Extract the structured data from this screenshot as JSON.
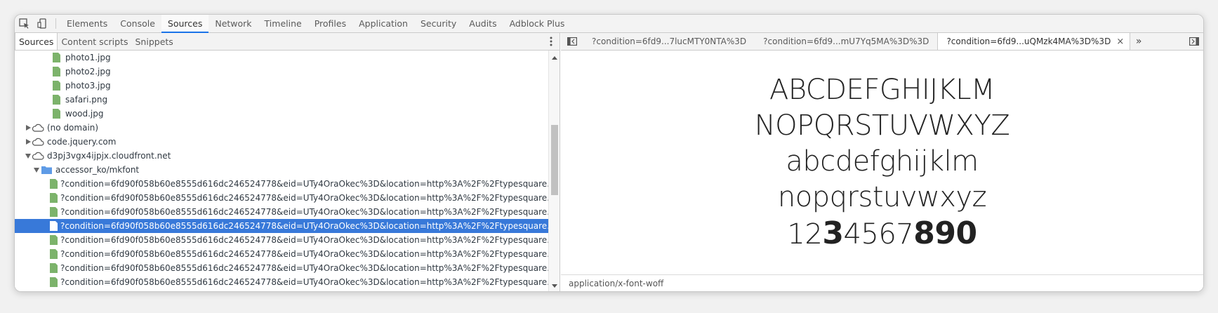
{
  "toolbar": {
    "tabs": [
      {
        "label": "Elements"
      },
      {
        "label": "Console"
      },
      {
        "label": "Sources"
      },
      {
        "label": "Network"
      },
      {
        "label": "Timeline"
      },
      {
        "label": "Profiles"
      },
      {
        "label": "Application"
      },
      {
        "label": "Security"
      },
      {
        "label": "Audits"
      },
      {
        "label": "Adblock Plus"
      }
    ],
    "active_tab": "Sources"
  },
  "navigator": {
    "tabs": [
      {
        "label": "Sources"
      },
      {
        "label": "Content scripts"
      },
      {
        "label": "Snippets"
      }
    ]
  },
  "tree": {
    "files_top": [
      {
        "label": "photo1.jpg"
      },
      {
        "label": "photo2.jpg"
      },
      {
        "label": "photo3.jpg"
      },
      {
        "label": "safari.png"
      },
      {
        "label": "wood.jpg"
      }
    ],
    "domains": [
      {
        "label": "(no domain)"
      },
      {
        "label": "code.jquery.com"
      },
      {
        "label": "d3pj3vgx4ijpjx.cloudfront.net"
      }
    ],
    "folder": {
      "label": "accessor_ko/mkfont"
    },
    "font_files": [
      {
        "label": "?condition=6fd90f058b60e8555d616dc246524778&eid=UTy4OraOkec%3D&location=http%3A%2F%2Ftypesquare.com..."
      },
      {
        "label": "?condition=6fd90f058b60e8555d616dc246524778&eid=UTy4OraOkec%3D&location=http%3A%2F%2Ftypesquare.com..."
      },
      {
        "label": "?condition=6fd90f058b60e8555d616dc246524778&eid=UTy4OraOkec%3D&location=http%3A%2F%2Ftypesquare.com..."
      },
      {
        "label": "?condition=6fd90f058b60e8555d616dc246524778&eid=UTy4OraOkec%3D&location=http%3A%2F%2Ftypesquare.com..."
      },
      {
        "label": "?condition=6fd90f058b60e8555d616dc246524778&eid=UTy4OraOkec%3D&location=http%3A%2F%2Ftypesquare.com..."
      },
      {
        "label": "?condition=6fd90f058b60e8555d616dc246524778&eid=UTy4OraOkec%3D&location=http%3A%2F%2Ftypesquare.com..."
      },
      {
        "label": "?condition=6fd90f058b60e8555d616dc246524778&eid=UTy4OraOkec%3D&location=http%3A%2F%2Ftypesquare.com..."
      },
      {
        "label": "?condition=6fd90f058b60e8555d616dc246524778&eid=UTy4OraOkec%3D&location=http%3A%2F%2Ftypesquare.com..."
      }
    ],
    "selected_index": 3
  },
  "editor": {
    "tabs": [
      {
        "label": "?condition=6fd9...7lucMTY0NTA%3D"
      },
      {
        "label": "?condition=6fd9...mU7Yq5MA%3D%3D"
      },
      {
        "label": "?condition=6fd9...uQMzk4MA%3D%3D"
      }
    ],
    "close_glyph": "×",
    "more_glyph": "»",
    "preview": {
      "upper1": "ABCDEFGHIJKLM",
      "upper2": "NOPQRSTUVWXYZ",
      "lower1": "abcdefghijklm",
      "lower2": "nopqrstuvwxyz",
      "digits_a": "12",
      "digits_b": "3",
      "digits_c": "4567",
      "digits_d": "890"
    },
    "status": "application/x-font-woff"
  },
  "colors": {
    "accent": "#1a73e8",
    "selection": "#3879d9",
    "file_icon": "#7cb36b",
    "folder_icon": "#5e9be6"
  }
}
